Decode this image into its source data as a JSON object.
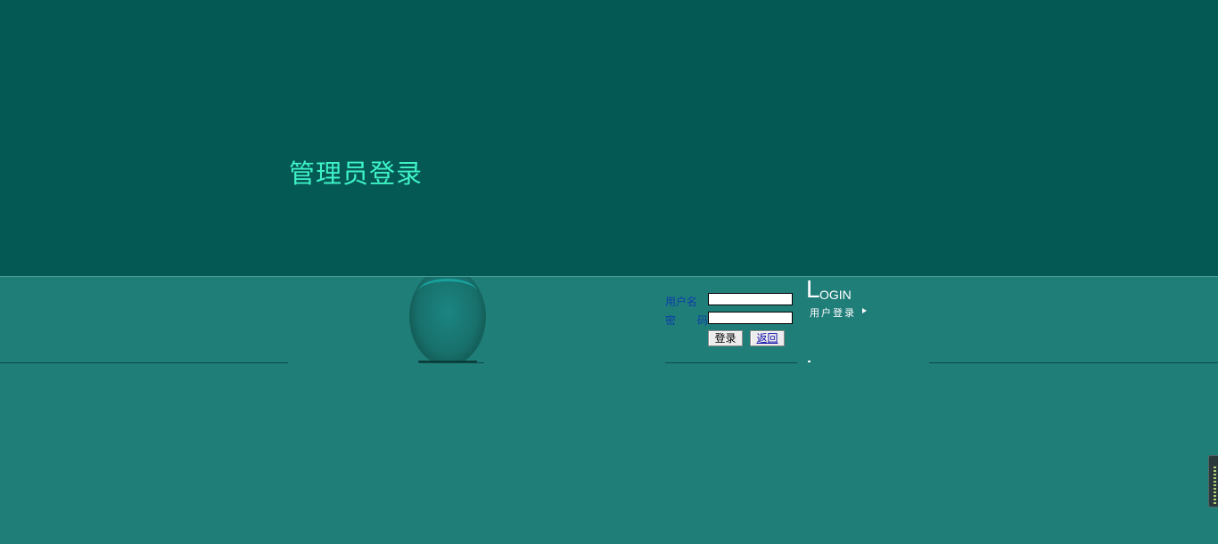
{
  "header": {
    "title": "管理员登录"
  },
  "login_form": {
    "username_label": "用户名",
    "username_value": "",
    "password_label": "密　　码",
    "password_value": "",
    "submit_label": "登录",
    "back_label": "返回"
  },
  "logo": {
    "big_letter": "L",
    "rest_letters": "OGIN",
    "subtitle": "用户登录"
  },
  "colors": {
    "top_band": "#055955",
    "page_background": "#207e79",
    "title_color": "#3ef2c6",
    "label_color": "#0b3fa8"
  },
  "icons": {
    "logo_arrow": "triangle-right-icon",
    "side_widget": "side-panel-handle-icon"
  }
}
